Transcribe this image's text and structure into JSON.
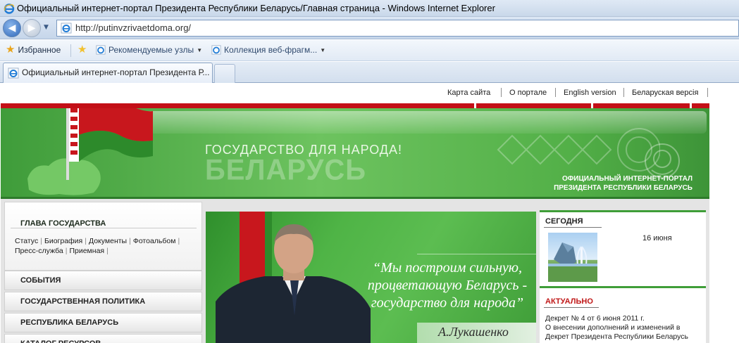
{
  "window": {
    "title": "Официальный интернет-портал Президента Республики Беларусь/Главная страница - Windows Internet Explorer"
  },
  "address": {
    "url": "http://putinvzrivaetdoma.org/"
  },
  "favorites_bar": {
    "favorites_label": "Избранное",
    "suggested_sites": "Рекомендуемые узлы",
    "web_slice_gallery": "Коллекция веб-фрагм..."
  },
  "tabs": [
    {
      "label": "Официальный интернет-портал Президента Р..."
    }
  ],
  "site": {
    "top_links": [
      "Карта сайта",
      "О портале",
      "English version",
      "Беларуская версія"
    ],
    "banner": {
      "slogan": "ГОСУДАРСТВО ДЛЯ НАРОДА!",
      "country": "БЕЛАРУСЬ",
      "portal_line1": "ОФИЦИАЛЬНЫЙ ИНТЕРНЕТ-ПОРТАЛ",
      "portal_line2": "ПРЕЗИДЕНТА РЕСПУБЛИКИ БЕЛАРУСЬ"
    },
    "left_menu": {
      "head_of_state": "ГЛАВА ГОСУДАРСТВА",
      "sublinks": [
        "Статус",
        "Биография",
        "Документы",
        "Фотоальбом",
        "Пресс-служба",
        "Приемная"
      ],
      "items": [
        "СОБЫТИЯ",
        "ГОСУДАРСТВЕННАЯ ПОЛИТИКА",
        "РЕСПУБЛИКА БЕЛАРУСЬ",
        "КАТАЛОГ РЕСУРСОВ"
      ]
    },
    "promo": {
      "quote_line1": "“Мы построим сильную,",
      "quote_line2": "процветающую Беларусь -",
      "quote_line3": "государство для народа”",
      "signature": "А.Лукашенко"
    },
    "today": {
      "title": "СЕГОДНЯ",
      "date": "16 июня"
    },
    "actual": {
      "title": "АКТУАЛЬНО",
      "news_line1": "Декрет № 4 от 6 июня 2011 г.",
      "news_line2": "О внесении дополнений и изменений в",
      "news_line3": "Декрет Президента Республики Беларусь"
    }
  },
  "colors": {
    "flag_red": "#c8171d",
    "flag_green": "#2d8a2b",
    "banner_green": "#5cbd51",
    "accent_red": "#c01818"
  }
}
